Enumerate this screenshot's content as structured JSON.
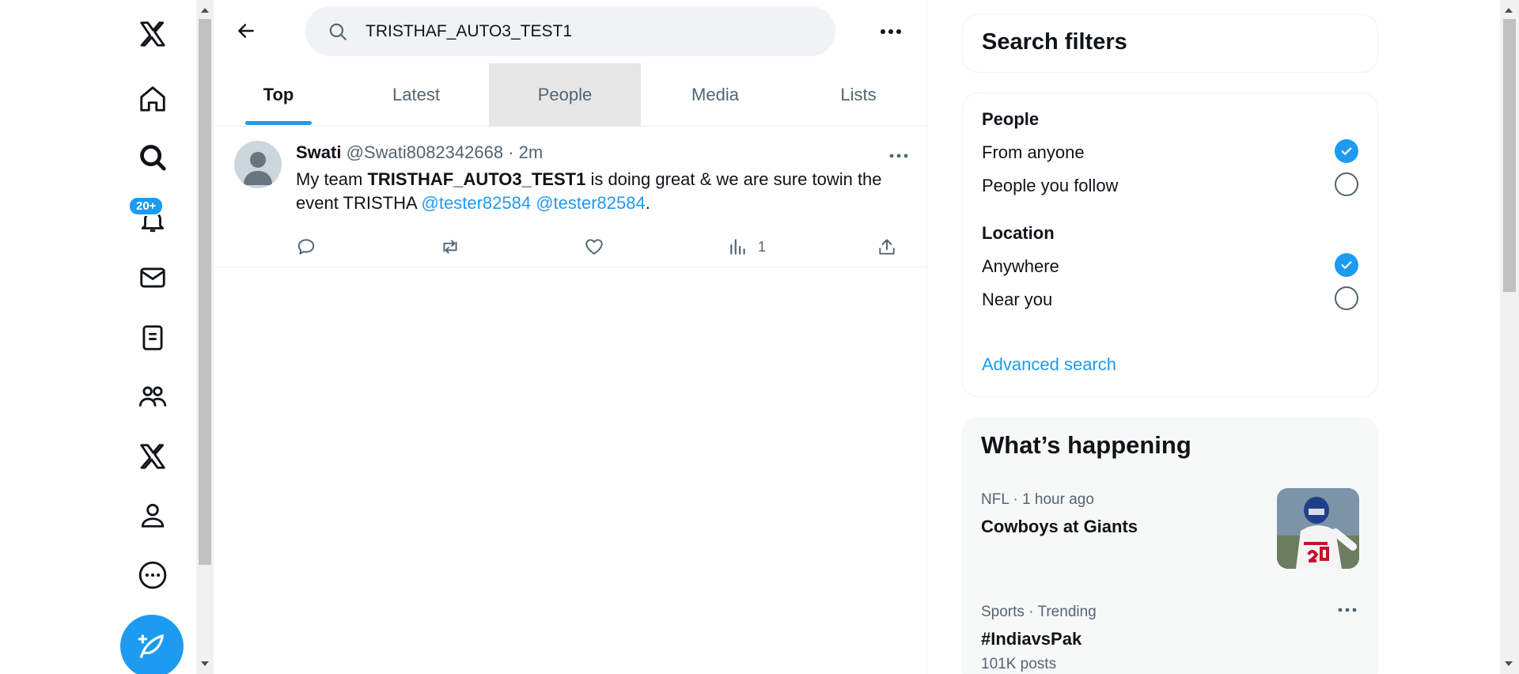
{
  "search": {
    "value": "TRISTHAF_AUTO3_TEST1"
  },
  "nav": {
    "notification_badge": "20+"
  },
  "tabs": [
    {
      "label": "Top"
    },
    {
      "label": "Latest"
    },
    {
      "label": "People"
    },
    {
      "label": "Media"
    },
    {
      "label": "Lists"
    }
  ],
  "tweet": {
    "name": "Swati",
    "handle": "@Swati8082342668",
    "separator": " · ",
    "time": "2m",
    "text_prefix": "My team ",
    "text_bold": "TRISTHAF_AUTO3_TEST1",
    "text_middle": " is doing great & we are sure towin the event TRISTHA ",
    "mention_1": "@tester82584",
    "mention_2": "@tester82584",
    "text_end": ".",
    "views": "1"
  },
  "search_filters": {
    "title": "Search filters",
    "people_heading": "People",
    "people_options": [
      "From anyone",
      "People you follow"
    ],
    "location_heading": "Location",
    "location_options": [
      "Anywhere",
      "Near you"
    ],
    "advanced_link": "Advanced search"
  },
  "whats_happening": {
    "title": "What’s happening",
    "trends": [
      {
        "meta": "NFL · 1 hour ago",
        "title": "Cowboys at Giants"
      },
      {
        "meta": "Sports · Trending",
        "title": "#IndiavsPak",
        "count": "101K posts"
      }
    ]
  },
  "colors": {
    "accent": "#1d9bf0",
    "text": "#0f1419",
    "muted": "#536471"
  }
}
